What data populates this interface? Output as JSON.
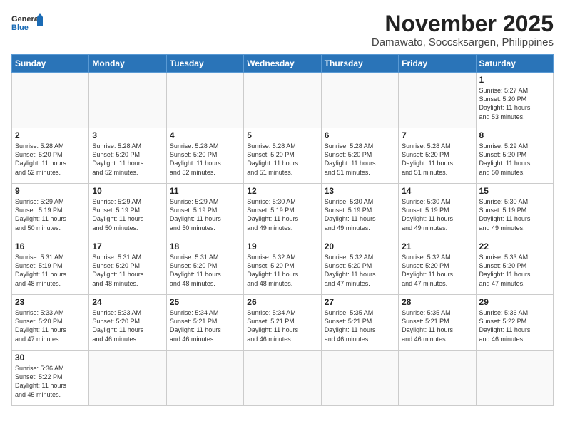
{
  "header": {
    "logo_general": "General",
    "logo_blue": "Blue",
    "month_year": "November 2025",
    "location": "Damawato, Soccsksargen, Philippines"
  },
  "weekdays": [
    "Sunday",
    "Monday",
    "Tuesday",
    "Wednesday",
    "Thursday",
    "Friday",
    "Saturday"
  ],
  "weeks": [
    [
      {
        "day": "",
        "content": ""
      },
      {
        "day": "",
        "content": ""
      },
      {
        "day": "",
        "content": ""
      },
      {
        "day": "",
        "content": ""
      },
      {
        "day": "",
        "content": ""
      },
      {
        "day": "",
        "content": ""
      },
      {
        "day": "1",
        "content": "Sunrise: 5:27 AM\nSunset: 5:20 PM\nDaylight: 11 hours\nand 53 minutes."
      }
    ],
    [
      {
        "day": "2",
        "content": "Sunrise: 5:28 AM\nSunset: 5:20 PM\nDaylight: 11 hours\nand 52 minutes."
      },
      {
        "day": "3",
        "content": "Sunrise: 5:28 AM\nSunset: 5:20 PM\nDaylight: 11 hours\nand 52 minutes."
      },
      {
        "day": "4",
        "content": "Sunrise: 5:28 AM\nSunset: 5:20 PM\nDaylight: 11 hours\nand 52 minutes."
      },
      {
        "day": "5",
        "content": "Sunrise: 5:28 AM\nSunset: 5:20 PM\nDaylight: 11 hours\nand 51 minutes."
      },
      {
        "day": "6",
        "content": "Sunrise: 5:28 AM\nSunset: 5:20 PM\nDaylight: 11 hours\nand 51 minutes."
      },
      {
        "day": "7",
        "content": "Sunrise: 5:28 AM\nSunset: 5:20 PM\nDaylight: 11 hours\nand 51 minutes."
      },
      {
        "day": "8",
        "content": "Sunrise: 5:29 AM\nSunset: 5:20 PM\nDaylight: 11 hours\nand 50 minutes."
      }
    ],
    [
      {
        "day": "9",
        "content": "Sunrise: 5:29 AM\nSunset: 5:19 PM\nDaylight: 11 hours\nand 50 minutes."
      },
      {
        "day": "10",
        "content": "Sunrise: 5:29 AM\nSunset: 5:19 PM\nDaylight: 11 hours\nand 50 minutes."
      },
      {
        "day": "11",
        "content": "Sunrise: 5:29 AM\nSunset: 5:19 PM\nDaylight: 11 hours\nand 50 minutes."
      },
      {
        "day": "12",
        "content": "Sunrise: 5:30 AM\nSunset: 5:19 PM\nDaylight: 11 hours\nand 49 minutes."
      },
      {
        "day": "13",
        "content": "Sunrise: 5:30 AM\nSunset: 5:19 PM\nDaylight: 11 hours\nand 49 minutes."
      },
      {
        "day": "14",
        "content": "Sunrise: 5:30 AM\nSunset: 5:19 PM\nDaylight: 11 hours\nand 49 minutes."
      },
      {
        "day": "15",
        "content": "Sunrise: 5:30 AM\nSunset: 5:19 PM\nDaylight: 11 hours\nand 49 minutes."
      }
    ],
    [
      {
        "day": "16",
        "content": "Sunrise: 5:31 AM\nSunset: 5:19 PM\nDaylight: 11 hours\nand 48 minutes."
      },
      {
        "day": "17",
        "content": "Sunrise: 5:31 AM\nSunset: 5:20 PM\nDaylight: 11 hours\nand 48 minutes."
      },
      {
        "day": "18",
        "content": "Sunrise: 5:31 AM\nSunset: 5:20 PM\nDaylight: 11 hours\nand 48 minutes."
      },
      {
        "day": "19",
        "content": "Sunrise: 5:32 AM\nSunset: 5:20 PM\nDaylight: 11 hours\nand 48 minutes."
      },
      {
        "day": "20",
        "content": "Sunrise: 5:32 AM\nSunset: 5:20 PM\nDaylight: 11 hours\nand 47 minutes."
      },
      {
        "day": "21",
        "content": "Sunrise: 5:32 AM\nSunset: 5:20 PM\nDaylight: 11 hours\nand 47 minutes."
      },
      {
        "day": "22",
        "content": "Sunrise: 5:33 AM\nSunset: 5:20 PM\nDaylight: 11 hours\nand 47 minutes."
      }
    ],
    [
      {
        "day": "23",
        "content": "Sunrise: 5:33 AM\nSunset: 5:20 PM\nDaylight: 11 hours\nand 47 minutes."
      },
      {
        "day": "24",
        "content": "Sunrise: 5:33 AM\nSunset: 5:20 PM\nDaylight: 11 hours\nand 46 minutes."
      },
      {
        "day": "25",
        "content": "Sunrise: 5:34 AM\nSunset: 5:21 PM\nDaylight: 11 hours\nand 46 minutes."
      },
      {
        "day": "26",
        "content": "Sunrise: 5:34 AM\nSunset: 5:21 PM\nDaylight: 11 hours\nand 46 minutes."
      },
      {
        "day": "27",
        "content": "Sunrise: 5:35 AM\nSunset: 5:21 PM\nDaylight: 11 hours\nand 46 minutes."
      },
      {
        "day": "28",
        "content": "Sunrise: 5:35 AM\nSunset: 5:21 PM\nDaylight: 11 hours\nand 46 minutes."
      },
      {
        "day": "29",
        "content": "Sunrise: 5:36 AM\nSunset: 5:22 PM\nDaylight: 11 hours\nand 46 minutes."
      }
    ],
    [
      {
        "day": "30",
        "content": "Sunrise: 5:36 AM\nSunset: 5:22 PM\nDaylight: 11 hours\nand 45 minutes."
      },
      {
        "day": "",
        "content": ""
      },
      {
        "day": "",
        "content": ""
      },
      {
        "day": "",
        "content": ""
      },
      {
        "day": "",
        "content": ""
      },
      {
        "day": "",
        "content": ""
      },
      {
        "day": "",
        "content": ""
      }
    ]
  ]
}
